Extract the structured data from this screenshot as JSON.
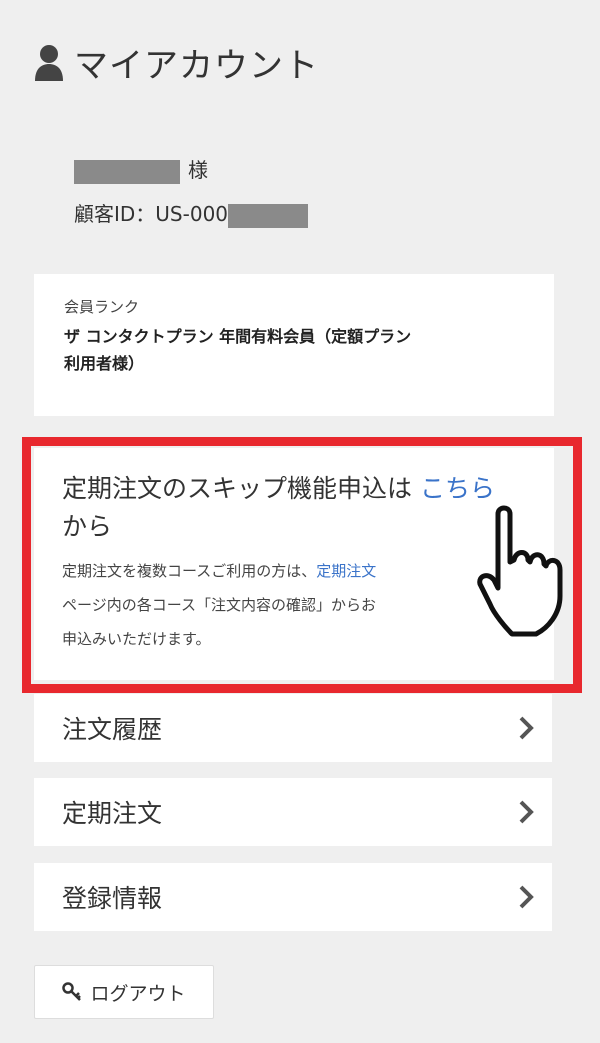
{
  "header": {
    "title": "マイアカウント"
  },
  "customer": {
    "honorific": "様",
    "id_prefix": "顧客ID：US-000"
  },
  "rank": {
    "label": "会員ランク",
    "value_line1": "ザ コンタクトプラン 年間有料会員（定額プラン",
    "value_line2": "利用者様）"
  },
  "skip": {
    "title_before": "定期注文のスキップ機能申込は ",
    "title_link": "こちら",
    "title_after": " から",
    "desc_line1_before": "定期注文を複数コースご利用の方は、",
    "desc_line1_link": "定期注文",
    "desc_line2": "ページ内の各コース「注文内容の確認」からお",
    "desc_line3": "申込みいただけます。"
  },
  "nav": {
    "items": [
      {
        "label": "注文履歴"
      },
      {
        "label": "定期注文"
      },
      {
        "label": "登録情報"
      }
    ]
  },
  "logout": {
    "label": "ログアウト"
  },
  "colors": {
    "highlight": "#e8282e",
    "link": "#3a73c9",
    "background": "#efefef"
  }
}
